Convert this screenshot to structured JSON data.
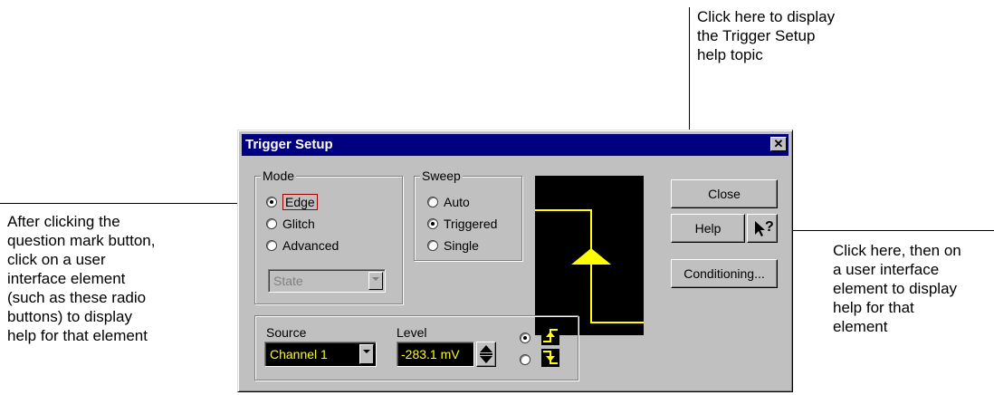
{
  "annotations": {
    "top_right": "Click here to display\nthe Trigger Setup\nhelp topic",
    "left": "After clicking the\nquestion mark button,\nclick on a user\ninterface element\n(such as these radio\nbuttons) to display\nhelp for that element",
    "right": "Click here, then on\na user interface\nelement to display\nhelp for that\nelement"
  },
  "dialog": {
    "title": "Trigger Setup",
    "mode": {
      "label": "Mode",
      "options": [
        "Edge",
        "Glitch",
        "Advanced"
      ],
      "selected": "Edge",
      "state_select": "State"
    },
    "sweep": {
      "label": "Sweep",
      "options": [
        "Auto",
        "Triggered",
        "Single"
      ],
      "selected": "Triggered"
    },
    "buttons": {
      "close": "Close",
      "help": "Help",
      "whats_this": "?",
      "conditioning": "Conditioning..."
    },
    "source": {
      "label": "Source",
      "value": "Channel 1"
    },
    "level": {
      "label": "Level",
      "value": "-283.1 mV"
    },
    "colors": {
      "trace": "#ffff00",
      "display_bg": "#000000",
      "titlebar": "#000080"
    }
  }
}
